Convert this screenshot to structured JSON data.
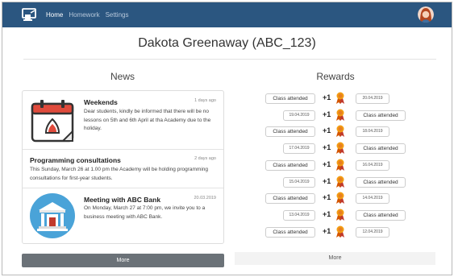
{
  "nav": {
    "items": [
      {
        "label": "Home",
        "active": true
      },
      {
        "label": "Homework",
        "active": false
      },
      {
        "label": "Settings",
        "active": false
      }
    ],
    "brand_color": "#2b5680"
  },
  "page": {
    "title": "Dakota Greenaway (ABC_123)",
    "news_heading": "News",
    "rewards_heading": "Rewards"
  },
  "news": [
    {
      "title": "Weekends",
      "date": "1 days ago",
      "body": "Dear students, kindly be informed that there will be no lessons on 5th and 6th April at tha Academy due to the holiday.",
      "icon": "calendar-icon"
    },
    {
      "title": "Programming consultations",
      "date": "2 days ago",
      "body": "This Sunday, March 26 at 1.00 pm the Academy will be holding programming consultations for first-year students.",
      "icon": ""
    },
    {
      "title": "Meeting with ABC Bank",
      "date": "20.03.2019",
      "body": "On Monday, March 27 at 7:00 pm, we invite you to a business meeting with ABC Bank.",
      "icon": "bank-icon"
    }
  ],
  "news_more_label": "More",
  "rewards": [
    {
      "left": "Class attended",
      "points": "+1",
      "right": "20.04.2019"
    },
    {
      "left": "19.04.2019",
      "points": "+1",
      "right": "Class attended"
    },
    {
      "left": "Class attended",
      "points": "+1",
      "right": "18.04.2019"
    },
    {
      "left": "17.04.2019",
      "points": "+1",
      "right": "Class attended"
    },
    {
      "left": "Class attended",
      "points": "+1",
      "right": "16.04.2019"
    },
    {
      "left": "15.04.2019",
      "points": "+1",
      "right": "Class attended"
    },
    {
      "left": "Class attended",
      "points": "+1",
      "right": "14.04.2019"
    },
    {
      "left": "13.04.2019",
      "points": "+1",
      "right": "Class attended"
    },
    {
      "left": "Class attended",
      "points": "+1",
      "right": "12.04.2019"
    }
  ],
  "rewards_more_label": "More"
}
